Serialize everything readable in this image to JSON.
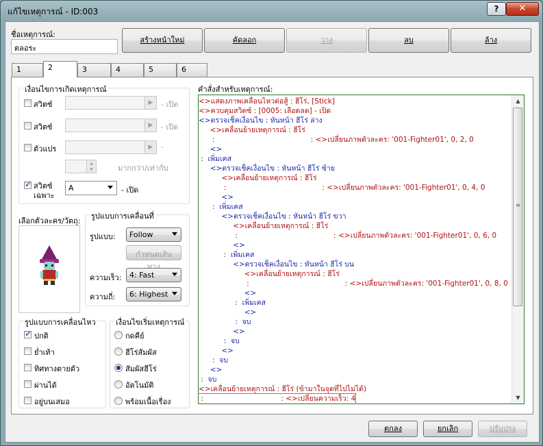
{
  "window": {
    "title": "แก้ไขเหตุการณ์ - ID:003",
    "help_label": "?",
    "close_label": "✕"
  },
  "event_name": {
    "label": "ชื่อเหตุการณ์:",
    "value": "ตลอระ"
  },
  "toolbar": {
    "new_page": "สร้างหน้าใหม่",
    "copy": "คัดลอก",
    "paste": "วาง",
    "delete": "ลบ",
    "clear": "ล้าง"
  },
  "tabs": [
    "1",
    "2",
    "3",
    "4",
    "5",
    "6"
  ],
  "conditions": {
    "title": "เงื่อนไขการเกิดเหตุการณ์",
    "switch1_label": "สวิตซ์",
    "switch1_suffix": "- เปิด",
    "switch2_label": "สวิตซ์",
    "switch2_suffix": "- เปิด",
    "variable_label": "ตัวแปร",
    "variable_suffix": "-",
    "variable_compare": "มากกว่า/เท่ากับ",
    "self_switch_label_1": "สวิตซ์",
    "self_switch_label_2": "เฉพาะ",
    "self_switch_value": "A",
    "self_switch_suffix": "- เปิด"
  },
  "graphic": {
    "label": "เลือกตัวละคร/วัตถุ:"
  },
  "movement": {
    "title": "รูปแบบการเคลื่อนที่",
    "type_label": "รูปแบบ:",
    "type_value": "Follow",
    "route_button": "กำหนดเส้นทาง",
    "speed_label": "ความเร็ว:",
    "speed_value": "4: Fast",
    "freq_label": "ความถี่:",
    "freq_value": "6: Highest"
  },
  "options": {
    "title": "รูปแบบการเคลื่อนไหว",
    "items": [
      {
        "label": "ปกติ",
        "checked": true
      },
      {
        "label": "ย่ำเท้า",
        "checked": false
      },
      {
        "label": "ทิศทางตายตัว",
        "checked": false
      },
      {
        "label": "ผ่านได้",
        "checked": false
      },
      {
        "label": "อยู่บนเสมอ",
        "checked": false
      }
    ]
  },
  "trigger": {
    "title": "เงื่อนไขเริ่มเหตุการณ์",
    "items": [
      {
        "label": "กดคีย์",
        "selected": false
      },
      {
        "label": "ฮีโร่สัมผัส",
        "selected": false
      },
      {
        "label": "สัมผัสฮีโร่",
        "selected": true
      },
      {
        "label": "อัตโนมัติ",
        "selected": false
      },
      {
        "label": "พร้อมเนื้อเรื่อง",
        "selected": false
      }
    ]
  },
  "commands": {
    "label": "คำสั่งสำหรับเหตุการณ์:",
    "lines": [
      {
        "text": "<>แสดงภาพเคลื่อนไหวต่อสู้ : ฮีโร่, [Stick]",
        "color": "red"
      },
      {
        "text": "<>ควบคุมสวิตซ์ : [0005: เลือดลด] - เปิด",
        "color": "red"
      },
      {
        "text": "<>ตรวจเช็คเงื่อนไข : หันหน้า ฮีโร่ ล่าง",
        "color": "blue"
      },
      {
        "text": "     <>เคลื่อนย้ายเหตุการณ์ : ฮีโร่",
        "color": "red"
      },
      {
        "text": "      :                                          : <>เปลี่ยนภาพตัวละคร: '001-Fighter01', 0, 2, 0",
        "color": "red"
      },
      {
        "text": "     <>",
        "color": "blue"
      },
      {
        "text": " :  เพิ่มเคส",
        "color": "blue"
      },
      {
        "text": "     <>ตรวจเช็คเงื่อนไข : หันหน้า ฮีโร่ ซ้าย",
        "color": "blue"
      },
      {
        "text": "          <>เคลื่อนย้ายเหตุการณ์ : ฮีโร่",
        "color": "red"
      },
      {
        "text": "           :                                          : <>เปลี่ยนภาพตัวละคร: '001-Fighter01', 0, 4, 0",
        "color": "red"
      },
      {
        "text": "          <>",
        "color": "blue"
      },
      {
        "text": "      :  เพิ่มเคส",
        "color": "blue"
      },
      {
        "text": "          <>ตรวจเช็คเงื่อนไข : หันหน้า ฮีโร่ ขวา",
        "color": "blue"
      },
      {
        "text": "               <>เคลื่อนย้ายเหตุการณ์ : ฮีโร่",
        "color": "red"
      },
      {
        "text": "                :                                          : <>เปลี่ยนภาพตัวละคร: '001-Fighter01', 0, 6, 0",
        "color": "red"
      },
      {
        "text": "               <>",
        "color": "blue"
      },
      {
        "text": "           :  เพิ่มเคส",
        "color": "blue"
      },
      {
        "text": "               <>ตรวจเช็คเงื่อนไข : หันหน้า ฮีโร่ บน",
        "color": "blue"
      },
      {
        "text": "                    <>เคลื่อนย้ายเหตุการณ์ : ฮีโร่",
        "color": "red"
      },
      {
        "text": "                     :                                          : <>เปลี่ยนภาพตัวละคร: '001-Fighter01', 0, 8, 0",
        "color": "red"
      },
      {
        "text": "                    <>",
        "color": "blue"
      },
      {
        "text": "                :  เพิ่มเคส",
        "color": "blue"
      },
      {
        "text": "                    <>",
        "color": "blue"
      },
      {
        "text": "                :  จบ",
        "color": "blue"
      },
      {
        "text": "               <>",
        "color": "blue"
      },
      {
        "text": "           :  จบ",
        "color": "blue"
      },
      {
        "text": "          <>",
        "color": "blue"
      },
      {
        "text": "      :  จบ",
        "color": "blue"
      },
      {
        "text": "     <>",
        "color": "blue"
      },
      {
        "text": " :  จบ",
        "color": "blue"
      },
      {
        "text": "<>เคลื่อนย้ายเหตุการณ์ : ฮีโร่ (ข้ามาในจุดที่ไปไม่ได้)",
        "color": "red"
      },
      {
        "text": " :                                  : <>เปลี่ยนความเร็ว: 4",
        "color": "red"
      }
    ]
  },
  "footer": {
    "ok": "ตกลง",
    "cancel": "ยกเลิก",
    "apply": "ปรับปรุง"
  },
  "colors": {
    "command_red": "#b01010",
    "command_blue": "#1b2aa8",
    "list_border": "#2b7a2b"
  }
}
